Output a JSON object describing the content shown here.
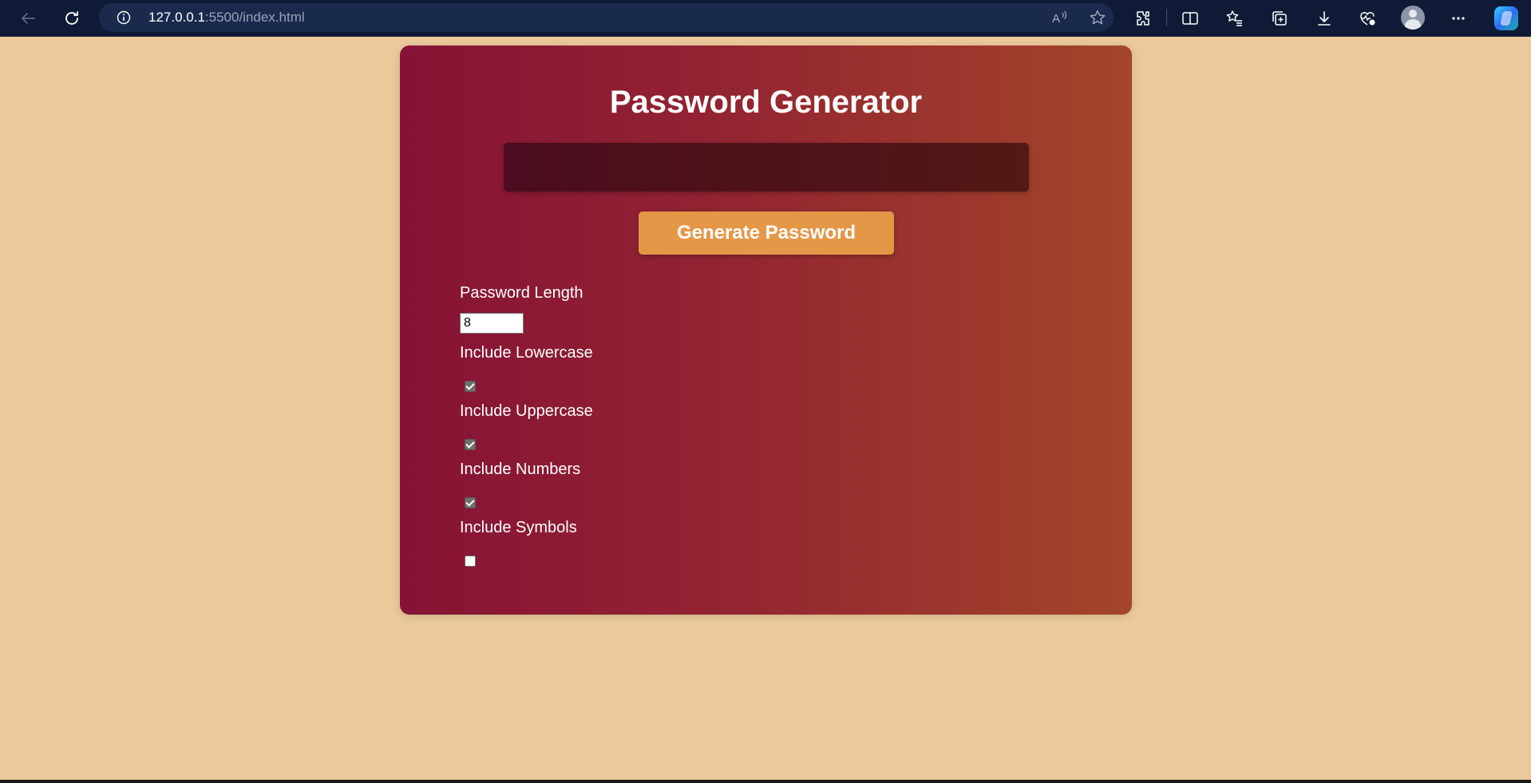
{
  "browser": {
    "url_host": "127.0.0.1",
    "url_rest": ":5500/index.html",
    "icons": [
      "back-icon",
      "refresh-icon",
      "info-icon",
      "read-aloud-icon",
      "favorite-star-icon",
      "extensions-icon",
      "split-screen-icon",
      "favorites-icon",
      "collections-icon",
      "download-icon",
      "performance-icon",
      "profile-avatar",
      "more-icon",
      "copilot-icon"
    ]
  },
  "app": {
    "title": "Password Generator",
    "output_value": "",
    "generate_label": "Generate Password",
    "length_label": "Password Length",
    "length_value": "8",
    "options": [
      {
        "label": "Include Lowercase",
        "checked": true
      },
      {
        "label": "Include Uppercase",
        "checked": true
      },
      {
        "label": "Include Numbers",
        "checked": true
      },
      {
        "label": "Include Symbols",
        "checked": false
      }
    ]
  },
  "colors": {
    "page_bg": "#ebc99b",
    "card_start": "#861235",
    "card_end": "#a3462a",
    "button": "#e59748",
    "chrome_bg": "#0f1b36"
  }
}
